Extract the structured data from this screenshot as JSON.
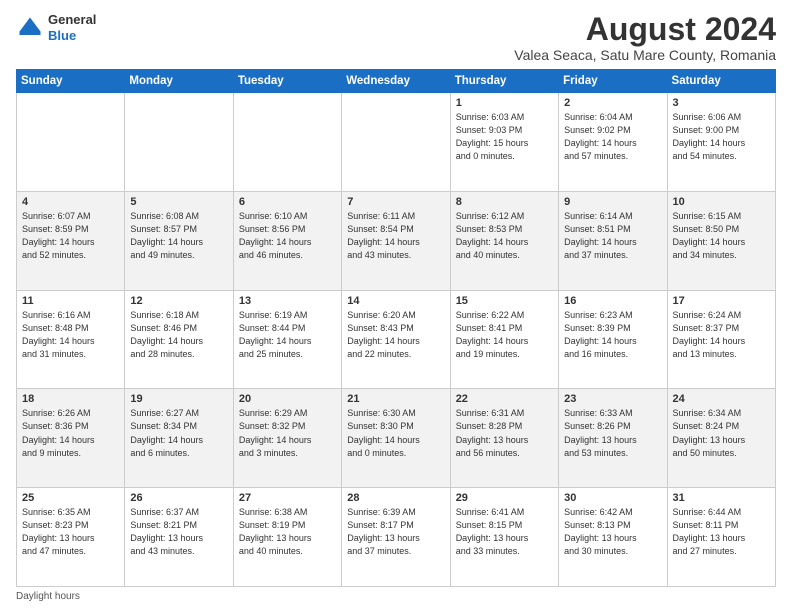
{
  "logo": {
    "general": "General",
    "blue": "Blue"
  },
  "title": "August 2024",
  "subtitle": "Valea Seaca, Satu Mare County, Romania",
  "weekdays": [
    "Sunday",
    "Monday",
    "Tuesday",
    "Wednesday",
    "Thursday",
    "Friday",
    "Saturday"
  ],
  "footer": "Daylight hours",
  "weeks": [
    [
      {
        "day": "",
        "info": ""
      },
      {
        "day": "",
        "info": ""
      },
      {
        "day": "",
        "info": ""
      },
      {
        "day": "",
        "info": ""
      },
      {
        "day": "1",
        "info": "Sunrise: 6:03 AM\nSunset: 9:03 PM\nDaylight: 15 hours\nand 0 minutes."
      },
      {
        "day": "2",
        "info": "Sunrise: 6:04 AM\nSunset: 9:02 PM\nDaylight: 14 hours\nand 57 minutes."
      },
      {
        "day": "3",
        "info": "Sunrise: 6:06 AM\nSunset: 9:00 PM\nDaylight: 14 hours\nand 54 minutes."
      }
    ],
    [
      {
        "day": "4",
        "info": "Sunrise: 6:07 AM\nSunset: 8:59 PM\nDaylight: 14 hours\nand 52 minutes."
      },
      {
        "day": "5",
        "info": "Sunrise: 6:08 AM\nSunset: 8:57 PM\nDaylight: 14 hours\nand 49 minutes."
      },
      {
        "day": "6",
        "info": "Sunrise: 6:10 AM\nSunset: 8:56 PM\nDaylight: 14 hours\nand 46 minutes."
      },
      {
        "day": "7",
        "info": "Sunrise: 6:11 AM\nSunset: 8:54 PM\nDaylight: 14 hours\nand 43 minutes."
      },
      {
        "day": "8",
        "info": "Sunrise: 6:12 AM\nSunset: 8:53 PM\nDaylight: 14 hours\nand 40 minutes."
      },
      {
        "day": "9",
        "info": "Sunrise: 6:14 AM\nSunset: 8:51 PM\nDaylight: 14 hours\nand 37 minutes."
      },
      {
        "day": "10",
        "info": "Sunrise: 6:15 AM\nSunset: 8:50 PM\nDaylight: 14 hours\nand 34 minutes."
      }
    ],
    [
      {
        "day": "11",
        "info": "Sunrise: 6:16 AM\nSunset: 8:48 PM\nDaylight: 14 hours\nand 31 minutes."
      },
      {
        "day": "12",
        "info": "Sunrise: 6:18 AM\nSunset: 8:46 PM\nDaylight: 14 hours\nand 28 minutes."
      },
      {
        "day": "13",
        "info": "Sunrise: 6:19 AM\nSunset: 8:44 PM\nDaylight: 14 hours\nand 25 minutes."
      },
      {
        "day": "14",
        "info": "Sunrise: 6:20 AM\nSunset: 8:43 PM\nDaylight: 14 hours\nand 22 minutes."
      },
      {
        "day": "15",
        "info": "Sunrise: 6:22 AM\nSunset: 8:41 PM\nDaylight: 14 hours\nand 19 minutes."
      },
      {
        "day": "16",
        "info": "Sunrise: 6:23 AM\nSunset: 8:39 PM\nDaylight: 14 hours\nand 16 minutes."
      },
      {
        "day": "17",
        "info": "Sunrise: 6:24 AM\nSunset: 8:37 PM\nDaylight: 14 hours\nand 13 minutes."
      }
    ],
    [
      {
        "day": "18",
        "info": "Sunrise: 6:26 AM\nSunset: 8:36 PM\nDaylight: 14 hours\nand 9 minutes."
      },
      {
        "day": "19",
        "info": "Sunrise: 6:27 AM\nSunset: 8:34 PM\nDaylight: 14 hours\nand 6 minutes."
      },
      {
        "day": "20",
        "info": "Sunrise: 6:29 AM\nSunset: 8:32 PM\nDaylight: 14 hours\nand 3 minutes."
      },
      {
        "day": "21",
        "info": "Sunrise: 6:30 AM\nSunset: 8:30 PM\nDaylight: 14 hours\nand 0 minutes."
      },
      {
        "day": "22",
        "info": "Sunrise: 6:31 AM\nSunset: 8:28 PM\nDaylight: 13 hours\nand 56 minutes."
      },
      {
        "day": "23",
        "info": "Sunrise: 6:33 AM\nSunset: 8:26 PM\nDaylight: 13 hours\nand 53 minutes."
      },
      {
        "day": "24",
        "info": "Sunrise: 6:34 AM\nSunset: 8:24 PM\nDaylight: 13 hours\nand 50 minutes."
      }
    ],
    [
      {
        "day": "25",
        "info": "Sunrise: 6:35 AM\nSunset: 8:23 PM\nDaylight: 13 hours\nand 47 minutes."
      },
      {
        "day": "26",
        "info": "Sunrise: 6:37 AM\nSunset: 8:21 PM\nDaylight: 13 hours\nand 43 minutes."
      },
      {
        "day": "27",
        "info": "Sunrise: 6:38 AM\nSunset: 8:19 PM\nDaylight: 13 hours\nand 40 minutes."
      },
      {
        "day": "28",
        "info": "Sunrise: 6:39 AM\nSunset: 8:17 PM\nDaylight: 13 hours\nand 37 minutes."
      },
      {
        "day": "29",
        "info": "Sunrise: 6:41 AM\nSunset: 8:15 PM\nDaylight: 13 hours\nand 33 minutes."
      },
      {
        "day": "30",
        "info": "Sunrise: 6:42 AM\nSunset: 8:13 PM\nDaylight: 13 hours\nand 30 minutes."
      },
      {
        "day": "31",
        "info": "Sunrise: 6:44 AM\nSunset: 8:11 PM\nDaylight: 13 hours\nand 27 minutes."
      }
    ]
  ]
}
